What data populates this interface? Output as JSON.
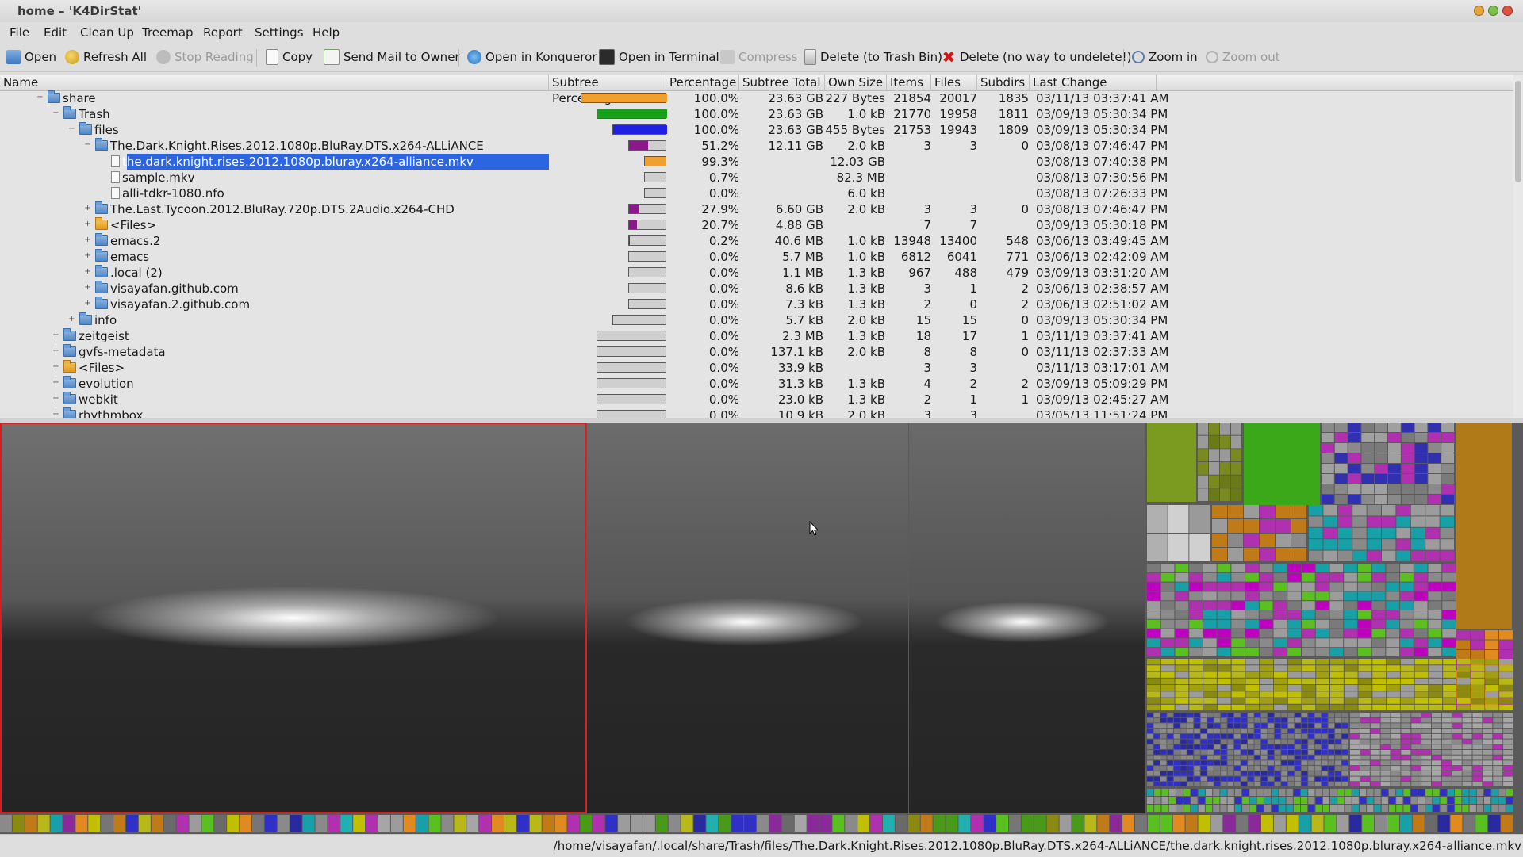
{
  "window": {
    "title": "home – 'K4DirStat'"
  },
  "menu": [
    "File",
    "Edit",
    "Clean Up",
    "Treemap",
    "Report",
    "Settings",
    "Help"
  ],
  "toolbar": {
    "open": "Open",
    "refresh": "Refresh All",
    "stop": "Stop Reading",
    "copy": "Copy",
    "mail": "Send Mail to Owner",
    "konqueror": "Open in Konqueror",
    "terminal": "Open in Terminal",
    "compress": "Compress",
    "trash": "Delete (to Trash Bin)",
    "delete": "Delete (no way to undelete!)",
    "zoom_in": "Zoom in",
    "zoom_out": "Zoom out"
  },
  "columns": [
    "Name",
    "Subtree Percentage",
    "Percentage",
    "Subtree Total",
    "Own Size",
    "Items",
    "Files",
    "Subdirs",
    "Last Change"
  ],
  "rows": [
    {
      "name": "share",
      "pct": "100.0%",
      "subtree": "23.63 GB",
      "own": "227 Bytes",
      "items": "21854",
      "files": "20017",
      "subdirs": "1835",
      "last": "03/11/13  03:37:41 AM"
    },
    {
      "name": "Trash",
      "pct": "100.0%",
      "subtree": "23.63 GB",
      "own": "1.0 kB",
      "items": "21770",
      "files": "19958",
      "subdirs": "1811",
      "last": "03/09/13  05:30:34 PM"
    },
    {
      "name": "files",
      "pct": "100.0%",
      "subtree": "23.63 GB",
      "own": "455 Bytes",
      "items": "21753",
      "files": "19943",
      "subdirs": "1809",
      "last": "03/09/13  05:30:34 PM"
    },
    {
      "name": "The.Dark.Knight.Rises.2012.1080p.BluRay.DTS.x264-ALLiANCE",
      "pct": "51.2%",
      "subtree": "12.11 GB",
      "own": "2.0 kB",
      "items": "3",
      "files": "3",
      "subdirs": "0",
      "last": "03/08/13  07:46:47 PM"
    },
    {
      "name": "the.dark.knight.rises.2012.1080p.bluray.x264-alliance.mkv",
      "pct": "99.3%",
      "subtree": "",
      "own": "12.03 GB",
      "items": "",
      "files": "",
      "subdirs": "",
      "last": "03/08/13  07:40:38 PM"
    },
    {
      "name": "sample.mkv",
      "pct": "0.7%",
      "subtree": "",
      "own": "82.3 MB",
      "items": "",
      "files": "",
      "subdirs": "",
      "last": "03/08/13  07:30:56 PM"
    },
    {
      "name": "alli-tdkr-1080.nfo",
      "pct": "0.0%",
      "subtree": "",
      "own": "6.0 kB",
      "items": "",
      "files": "",
      "subdirs": "",
      "last": "03/08/13  07:26:33 PM"
    },
    {
      "name": "The.Last.Tycoon.2012.BluRay.720p.DTS.2Audio.x264-CHD",
      "pct": "27.9%",
      "subtree": "6.60 GB",
      "own": "2.0 kB",
      "items": "3",
      "files": "3",
      "subdirs": "0",
      "last": "03/08/13  07:46:47 PM"
    },
    {
      "name": "<Files>",
      "pct": "20.7%",
      "subtree": "4.88 GB",
      "own": "",
      "items": "7",
      "files": "7",
      "subdirs": "",
      "last": "03/09/13  05:30:18 PM"
    },
    {
      "name": "emacs.2",
      "pct": "0.2%",
      "subtree": "40.6 MB",
      "own": "1.0 kB",
      "items": "13948",
      "files": "13400",
      "subdirs": "548",
      "last": "03/06/13  03:49:45 AM"
    },
    {
      "name": "emacs",
      "pct": "0.0%",
      "subtree": "5.7 MB",
      "own": "1.0 kB",
      "items": "6812",
      "files": "6041",
      "subdirs": "771",
      "last": "03/06/13  02:42:09 AM"
    },
    {
      "name": ".local (2)",
      "pct": "0.0%",
      "subtree": "1.1 MB",
      "own": "1.3 kB",
      "items": "967",
      "files": "488",
      "subdirs": "479",
      "last": "03/09/13  03:31:20 AM"
    },
    {
      "name": "visayafan.github.com",
      "pct": "0.0%",
      "subtree": "8.6 kB",
      "own": "1.3 kB",
      "items": "3",
      "files": "1",
      "subdirs": "2",
      "last": "03/06/13  02:38:57 AM"
    },
    {
      "name": "visayafan.2.github.com",
      "pct": "0.0%",
      "subtree": "7.3 kB",
      "own": "1.3 kB",
      "items": "2",
      "files": "0",
      "subdirs": "2",
      "last": "03/06/13  02:51:02 AM"
    },
    {
      "name": "info",
      "pct": "0.0%",
      "subtree": "5.7 kB",
      "own": "2.0 kB",
      "items": "15",
      "files": "15",
      "subdirs": "0",
      "last": "03/09/13  05:30:34 PM"
    },
    {
      "name": "zeitgeist",
      "pct": "0.0%",
      "subtree": "2.3 MB",
      "own": "1.3 kB",
      "items": "18",
      "files": "17",
      "subdirs": "1",
      "last": "03/11/13  03:37:41 AM"
    },
    {
      "name": "gvfs-metadata",
      "pct": "0.0%",
      "subtree": "137.1 kB",
      "own": "2.0 kB",
      "items": "8",
      "files": "8",
      "subdirs": "0",
      "last": "03/11/13  02:37:33 AM"
    },
    {
      "name": "<Files>",
      "pct": "0.0%",
      "subtree": "33.9 kB",
      "own": "",
      "items": "3",
      "files": "3",
      "subdirs": "",
      "last": "03/11/13  03:17:01 AM"
    },
    {
      "name": "evolution",
      "pct": "0.0%",
      "subtree": "31.3 kB",
      "own": "1.3 kB",
      "items": "4",
      "files": "2",
      "subdirs": "2",
      "last": "03/09/13  05:09:29 PM"
    },
    {
      "name": "webkit",
      "pct": "0.0%",
      "subtree": "23.0 kB",
      "own": "1.3 kB",
      "items": "2",
      "files": "1",
      "subdirs": "1",
      "last": "03/09/13  02:45:27 AM"
    },
    {
      "name": "rhythmbox",
      "pct": "0.0%",
      "subtree": "10.9 kB",
      "own": "2.0 kB",
      "items": "3",
      "files": "3",
      "subdirs": "",
      "last": "03/05/13  11:51:24 PM"
    }
  ],
  "statusbar": {
    "path": "/home/visayafan/.local/share/Trash/files/The.Dark.Knight.Rises.2012.1080p.BluRay.DTS.x264-ALLiANCE/the.dark.knight.rises.2012.1080p.bluray.x264-alliance.mkv"
  }
}
